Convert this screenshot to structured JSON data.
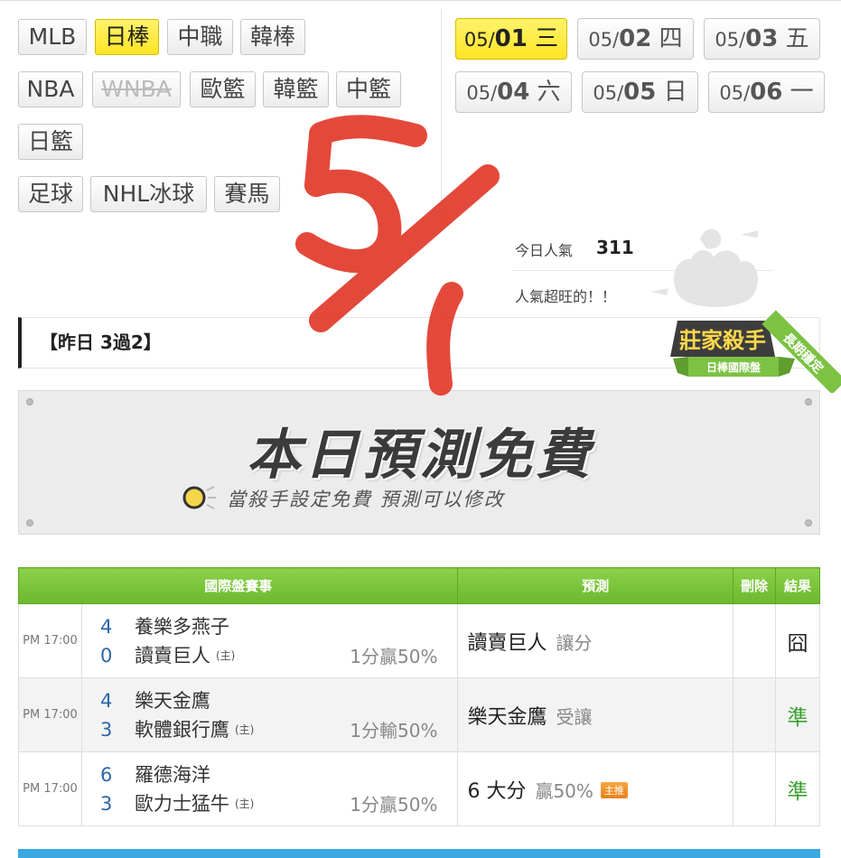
{
  "sports": {
    "row1": [
      {
        "label": "MLB",
        "active": false
      },
      {
        "label": "日棒",
        "active": true
      },
      {
        "label": "中職",
        "active": false
      },
      {
        "label": "韓棒",
        "active": false
      }
    ],
    "row2": [
      {
        "label": "NBA"
      },
      {
        "label": "WNBA"
      },
      {
        "label": "歐籃"
      },
      {
        "label": "韓籃"
      },
      {
        "label": "中籃"
      }
    ],
    "row3": [
      {
        "label": "日籃"
      }
    ],
    "row4": [
      {
        "label": "足球"
      },
      {
        "label": "NHL冰球"
      },
      {
        "label": "賽馬"
      }
    ]
  },
  "dates": [
    {
      "md": "05/",
      "day": "01",
      "weekday": "三",
      "active": true
    },
    {
      "md": "05/",
      "day": "02",
      "weekday": "四"
    },
    {
      "md": "05/",
      "day": "03",
      "weekday": "五"
    },
    {
      "md": "05/",
      "day": "04",
      "weekday": "六"
    },
    {
      "md": "05/",
      "day": "05",
      "weekday": "日"
    },
    {
      "md": "05/",
      "day": "06",
      "weekday": "一"
    }
  ],
  "popularity": {
    "label": "今日人氣",
    "value": "311",
    "message": "人氣超旺的！！"
  },
  "record": "【昨日 3過2】",
  "badge": {
    "title": "莊家殺手",
    "sub": "日棒國際盤",
    "ribbon": "長期穩定"
  },
  "free_banner": {
    "title": "本日預測免費",
    "subtitle": "當殺手設定免費 預測可以修改"
  },
  "table": {
    "headers": {
      "match": "國際盤賽事",
      "pred": "預測",
      "del": "刪除",
      "result": "結果"
    },
    "rows": [
      {
        "time": "PM 17:00",
        "away_score": "4",
        "away": "養樂多燕子",
        "home_score": "0",
        "home": "讀賣巨人",
        "home_tag": "(主)",
        "odds": "1分贏50%",
        "pick": "讀賣巨人",
        "pick_sub": "讓分",
        "result": "囧",
        "result_type": "lose"
      },
      {
        "time": "PM 17:00",
        "away_score": "4",
        "away": "樂天金鷹",
        "home_score": "3",
        "home": "軟體銀行鷹",
        "home_tag": "(主)",
        "odds": "1分輸50%",
        "pick": "樂天金鷹",
        "pick_sub": "受讓",
        "result": "準",
        "result_type": "win"
      },
      {
        "time": "PM 17:00",
        "away_score": "6",
        "away": "羅德海洋",
        "home_score": "3",
        "home": "歐力士猛牛",
        "home_tag": "(主)",
        "odds": "1分贏50%",
        "pick": "6 大分",
        "pick_sub": "贏50%",
        "main_tag": "主推",
        "result": "準",
        "result_type": "win"
      }
    ]
  },
  "colors": {
    "accent_yellow": "#ffe426",
    "header_green": "#6bb82e",
    "win_green": "#3aa031",
    "score_blue": "#2a67a8",
    "scribble_red": "#e03020"
  }
}
